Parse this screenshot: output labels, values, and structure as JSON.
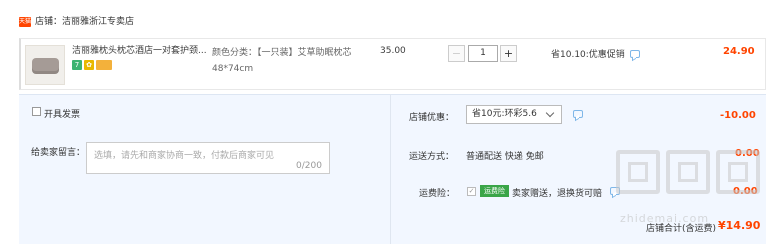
{
  "shop": {
    "badge": "天猫",
    "name": "店铺：洁丽雅浙江专卖店"
  },
  "item": {
    "title": "洁丽雅枕头枕芯酒店一对套护颈...",
    "tags": [
      "7",
      "✿",
      ""
    ],
    "sku": "颜色分类：【一只装】艾草助眠枕芯48*74cm",
    "unit_price": "35.00",
    "quantity": "1",
    "qty_minus": "−",
    "qty_plus": "+",
    "promo": "省10.10:优惠促销",
    "total": "24.90"
  },
  "invoice": {
    "label": "开具发票"
  },
  "message": {
    "label": "给卖家留言：",
    "placeholder": "选填，请先和商家协商一致，付款后商家可见",
    "counter": "0/200"
  },
  "shop_discount": {
    "label": "店铺优惠：",
    "selected": "省10元:环彩5.6",
    "amount": "-10.00"
  },
  "shipping": {
    "label": "运送方式：",
    "value": "普通配送 快递 免邮",
    "amount": "0.00"
  },
  "insurance": {
    "label": "运费险：",
    "badge": "运费险",
    "text": "卖家赠送，退换货可赔",
    "amount": "0.00"
  },
  "subtotal": {
    "label": "店铺合计(含运费)",
    "amount": "¥14.90"
  },
  "watermark": {
    "text": "zhidemai.com"
  },
  "colors": {
    "accent": "#ff4400",
    "panel": "#f2f7ff",
    "insurance_green": "#3aa548"
  }
}
